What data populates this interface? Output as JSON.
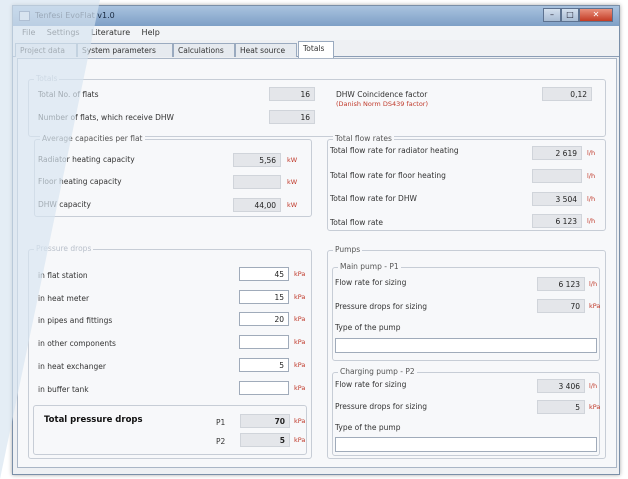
{
  "window": {
    "title": "Tenfesi EvoFlat v1.0",
    "buttons": {
      "minimize": "–",
      "maximize": "□",
      "close": "✕"
    }
  },
  "menu": [
    "File",
    "Settings",
    "Literature",
    "Help"
  ],
  "tabs": [
    "Project data",
    "System parameters",
    "Calculations",
    "Heat source",
    "Totals"
  ],
  "totals": {
    "legend": "Totals",
    "total_flats_label": "Total No. of flats",
    "total_flats_value": "16",
    "dhw_flats_label": "Number of flats, which receive DHW",
    "dhw_flats_value": "16",
    "coincidence_label": "DHW Coincidence factor",
    "coincidence_note": "(Danish Norm DS439 factor)",
    "coincidence_value": "0,12"
  },
  "avg_capacities": {
    "legend": "Average capacities per flat",
    "rows": [
      {
        "label": "Radiator heating capacity",
        "value": "5,56",
        "unit": "kW"
      },
      {
        "label": "Floor heating capacity",
        "value": "",
        "unit": "kW"
      },
      {
        "label": "DHW capacity",
        "value": "44,00",
        "unit": "kW"
      }
    ]
  },
  "flow_rates": {
    "legend": "Total flow rates",
    "rows": [
      {
        "label": "Total flow rate for radiator heating",
        "value": "2 619",
        "unit": "l/h"
      },
      {
        "label": "Total flow rate for floor heating",
        "value": "",
        "unit": "l/h"
      },
      {
        "label": "Total flow rate for DHW",
        "value": "3 504",
        "unit": "l/h"
      },
      {
        "label": "Total flow rate",
        "value": "6 123",
        "unit": "l/h"
      }
    ]
  },
  "pressure_drops": {
    "legend": "Pressure drops",
    "rows": [
      {
        "label": "in flat station",
        "value": "45",
        "unit": "kPa"
      },
      {
        "label": "in heat meter",
        "value": "15",
        "unit": "kPa"
      },
      {
        "label": "in pipes and fittings",
        "value": "20",
        "unit": "kPa"
      },
      {
        "label": "in other components",
        "value": "",
        "unit": "kPa"
      },
      {
        "label": "in heat exchanger",
        "value": "5",
        "unit": "kPa"
      },
      {
        "label": "in buffer tank",
        "value": "",
        "unit": "kPa"
      }
    ],
    "total_label": "Total pressure drops",
    "total_p1_label": "P1",
    "total_p1_value": "70",
    "total_p2_label": "P2",
    "total_p2_value": "5",
    "unit": "kPa"
  },
  "pumps": {
    "legend": "Pumps",
    "main": {
      "legend": "Main pump - P1",
      "flow_label": "Flow rate for sizing",
      "flow_value": "6 123",
      "flow_unit": "l/h",
      "pressure_label": "Pressure drops for sizing",
      "pressure_value": "70",
      "pressure_unit": "kPa",
      "type_label": "Type of the pump",
      "type_value": ""
    },
    "charging": {
      "legend": "Charging pump - P2",
      "flow_label": "Flow rate for sizing",
      "flow_value": "3 406",
      "flow_unit": "l/h",
      "pressure_label": "Pressure drops for sizing",
      "pressure_value": "5",
      "pressure_unit": "kPa",
      "type_label": "Type of the pump",
      "type_value": ""
    }
  }
}
